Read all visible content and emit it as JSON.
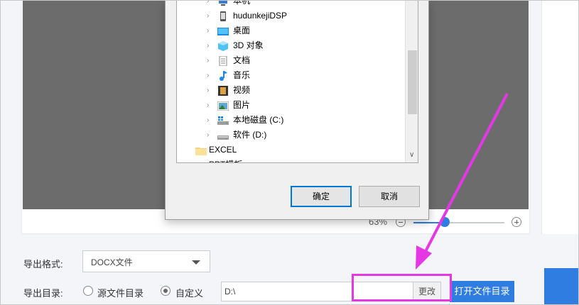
{
  "dialog": {
    "tree": [
      {
        "label": "本机",
        "icon": "computer-icon",
        "level": 1
      },
      {
        "label": "hudunkejiDSP",
        "icon": "phone-icon",
        "level": 1
      },
      {
        "label": "桌面",
        "icon": "desktop-icon",
        "level": 1
      },
      {
        "label": "3D 对象",
        "icon": "3d-objects-icon",
        "level": 1
      },
      {
        "label": "文档",
        "icon": "document-icon",
        "level": 1
      },
      {
        "label": "音乐",
        "icon": "music-icon",
        "level": 1
      },
      {
        "label": "视频",
        "icon": "video-icon",
        "level": 1
      },
      {
        "label": "图片",
        "icon": "picture-icon",
        "level": 1
      },
      {
        "label": "本地磁盘 (C:)",
        "icon": "windows-drive-icon",
        "level": 1
      },
      {
        "label": "软件 (D:)",
        "icon": "drive-icon",
        "level": 1
      },
      {
        "label": "EXCEL",
        "icon": "folder-icon",
        "level": 0
      },
      {
        "label": "PPT模板",
        "icon": "folder-icon",
        "level": 0
      }
    ],
    "ok_label": "确定",
    "cancel_label": "取消"
  },
  "zoom": {
    "percent_text": "63%",
    "level": 0.34
  },
  "form": {
    "format_label": "导出格式:",
    "format_value": "DOCX文件",
    "dir_label": "导出目录:",
    "radio_source_label": "源文件目录",
    "radio_custom_label": "自定义",
    "selected": "custom",
    "path_value": "D:\\",
    "change_label": "更改",
    "open_dir_label": "打开文件目录"
  },
  "colors": {
    "accent": "#2f7de1",
    "annotation": "#e637e6",
    "preview_bg": "#6c6c6c"
  }
}
